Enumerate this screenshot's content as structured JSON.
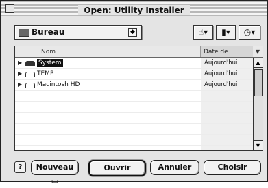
{
  "window": {
    "title": "Open: Utility Installer"
  },
  "location": {
    "label": "Bureau",
    "icon": "folder-icon"
  },
  "toolbar": [
    {
      "name": "shortcuts-button",
      "icon": "pointing-hand-icon",
      "glyph": "☝▾"
    },
    {
      "name": "favorites-button",
      "icon": "bookmark-icon",
      "glyph": "▮▾"
    },
    {
      "name": "recent-button",
      "icon": "clock-icon",
      "glyph": "◷▾"
    }
  ],
  "list": {
    "columns": {
      "name": "Nom",
      "date": "Date de modif..."
    },
    "rows": [
      {
        "name": "System",
        "date": "Aujourd'hui",
        "selected": true,
        "icon": "disk-icon"
      },
      {
        "name": "TEMP",
        "date": "Aujourd'hui",
        "selected": false,
        "icon": "disk-icon"
      },
      {
        "name": "Macintosh HD",
        "date": "Aujourd'hui",
        "selected": false,
        "icon": "disk-icon"
      }
    ]
  },
  "buttons": {
    "help": "?",
    "new_folder": "Nouveau",
    "open": "Ouvrir",
    "cancel": "Annuler",
    "choose": "Choisir"
  }
}
